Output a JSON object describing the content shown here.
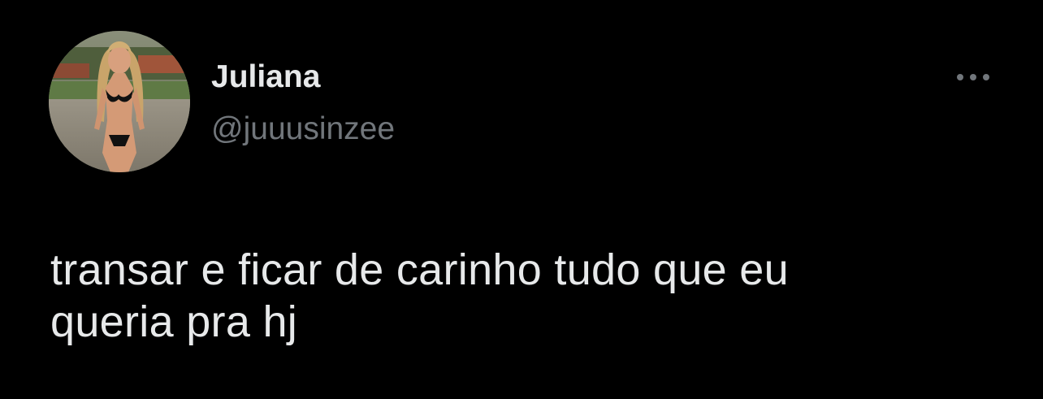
{
  "tweet": {
    "author": {
      "display_name": "Juliana",
      "handle": "@juuusinzee",
      "avatar_icon": "profile-photo"
    },
    "more_icon": "ellipsis-icon",
    "text_lines": [
      "transar e ficar de carinho tudo que eu",
      "queria pra hj"
    ]
  },
  "theme": {
    "background": "#000000",
    "primary_text": "#e7e9ea",
    "secondary_text": "#71767b"
  }
}
